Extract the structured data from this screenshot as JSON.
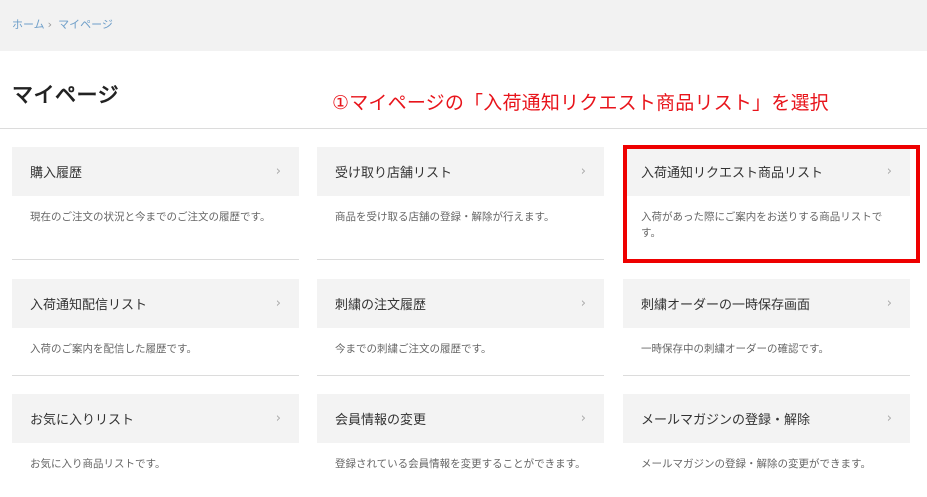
{
  "breadcrumb": {
    "home": "ホーム",
    "separator": "›",
    "current": "マイページ"
  },
  "page_title": "マイページ",
  "annotation": "①マイページの「入荷通知リクエスト商品リスト」を選択",
  "chevron": "›",
  "cards": [
    {
      "label": "購入履歴",
      "desc": "現在のご注文の状況と今までのご注文の履歴です。"
    },
    {
      "label": "受け取り店舗リスト",
      "desc": "商品を受け取る店舗の登録・解除が行えます。"
    },
    {
      "label": "入荷通知リクエスト商品リスト",
      "desc": "入荷があった際にご案内をお送りする商品リストです。"
    },
    {
      "label": "入荷通知配信リスト",
      "desc": "入荷のご案内を配信した履歴です。"
    },
    {
      "label": "刺繍の注文履歴",
      "desc": "今までの刺繍ご注文の履歴です。"
    },
    {
      "label": "刺繍オーダーの一時保存画面",
      "desc": "一時保存中の刺繍オーダーの確認です。"
    },
    {
      "label": "お気に入りリスト",
      "desc": "お気に入り商品リストです。"
    },
    {
      "label": "会員情報の変更",
      "desc": "登録されている会員情報を変更することができます。"
    },
    {
      "label": "メールマガジンの登録・解除",
      "desc": "メールマガジンの登録・解除の変更ができます。"
    }
  ]
}
